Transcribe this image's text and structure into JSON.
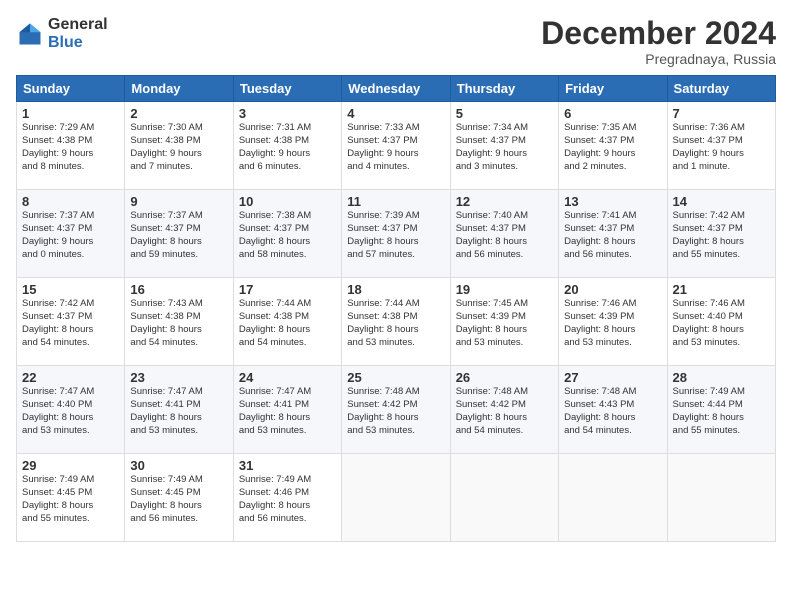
{
  "logo": {
    "general": "General",
    "blue": "Blue"
  },
  "header": {
    "month": "December 2024",
    "location": "Pregradnaya, Russia"
  },
  "weekdays": [
    "Sunday",
    "Monday",
    "Tuesday",
    "Wednesday",
    "Thursday",
    "Friday",
    "Saturday"
  ],
  "weeks": [
    [
      {
        "day": "1",
        "info": "Sunrise: 7:29 AM\nSunset: 4:38 PM\nDaylight: 9 hours\nand 8 minutes."
      },
      {
        "day": "2",
        "info": "Sunrise: 7:30 AM\nSunset: 4:38 PM\nDaylight: 9 hours\nand 7 minutes."
      },
      {
        "day": "3",
        "info": "Sunrise: 7:31 AM\nSunset: 4:38 PM\nDaylight: 9 hours\nand 6 minutes."
      },
      {
        "day": "4",
        "info": "Sunrise: 7:33 AM\nSunset: 4:37 PM\nDaylight: 9 hours\nand 4 minutes."
      },
      {
        "day": "5",
        "info": "Sunrise: 7:34 AM\nSunset: 4:37 PM\nDaylight: 9 hours\nand 3 minutes."
      },
      {
        "day": "6",
        "info": "Sunrise: 7:35 AM\nSunset: 4:37 PM\nDaylight: 9 hours\nand 2 minutes."
      },
      {
        "day": "7",
        "info": "Sunrise: 7:36 AM\nSunset: 4:37 PM\nDaylight: 9 hours\nand 1 minute."
      }
    ],
    [
      {
        "day": "8",
        "info": "Sunrise: 7:37 AM\nSunset: 4:37 PM\nDaylight: 9 hours\nand 0 minutes."
      },
      {
        "day": "9",
        "info": "Sunrise: 7:37 AM\nSunset: 4:37 PM\nDaylight: 8 hours\nand 59 minutes."
      },
      {
        "day": "10",
        "info": "Sunrise: 7:38 AM\nSunset: 4:37 PM\nDaylight: 8 hours\nand 58 minutes."
      },
      {
        "day": "11",
        "info": "Sunrise: 7:39 AM\nSunset: 4:37 PM\nDaylight: 8 hours\nand 57 minutes."
      },
      {
        "day": "12",
        "info": "Sunrise: 7:40 AM\nSunset: 4:37 PM\nDaylight: 8 hours\nand 56 minutes."
      },
      {
        "day": "13",
        "info": "Sunrise: 7:41 AM\nSunset: 4:37 PM\nDaylight: 8 hours\nand 56 minutes."
      },
      {
        "day": "14",
        "info": "Sunrise: 7:42 AM\nSunset: 4:37 PM\nDaylight: 8 hours\nand 55 minutes."
      }
    ],
    [
      {
        "day": "15",
        "info": "Sunrise: 7:42 AM\nSunset: 4:37 PM\nDaylight: 8 hours\nand 54 minutes."
      },
      {
        "day": "16",
        "info": "Sunrise: 7:43 AM\nSunset: 4:38 PM\nDaylight: 8 hours\nand 54 minutes."
      },
      {
        "day": "17",
        "info": "Sunrise: 7:44 AM\nSunset: 4:38 PM\nDaylight: 8 hours\nand 54 minutes."
      },
      {
        "day": "18",
        "info": "Sunrise: 7:44 AM\nSunset: 4:38 PM\nDaylight: 8 hours\nand 53 minutes."
      },
      {
        "day": "19",
        "info": "Sunrise: 7:45 AM\nSunset: 4:39 PM\nDaylight: 8 hours\nand 53 minutes."
      },
      {
        "day": "20",
        "info": "Sunrise: 7:46 AM\nSunset: 4:39 PM\nDaylight: 8 hours\nand 53 minutes."
      },
      {
        "day": "21",
        "info": "Sunrise: 7:46 AM\nSunset: 4:40 PM\nDaylight: 8 hours\nand 53 minutes."
      }
    ],
    [
      {
        "day": "22",
        "info": "Sunrise: 7:47 AM\nSunset: 4:40 PM\nDaylight: 8 hours\nand 53 minutes."
      },
      {
        "day": "23",
        "info": "Sunrise: 7:47 AM\nSunset: 4:41 PM\nDaylight: 8 hours\nand 53 minutes."
      },
      {
        "day": "24",
        "info": "Sunrise: 7:47 AM\nSunset: 4:41 PM\nDaylight: 8 hours\nand 53 minutes."
      },
      {
        "day": "25",
        "info": "Sunrise: 7:48 AM\nSunset: 4:42 PM\nDaylight: 8 hours\nand 53 minutes."
      },
      {
        "day": "26",
        "info": "Sunrise: 7:48 AM\nSunset: 4:42 PM\nDaylight: 8 hours\nand 54 minutes."
      },
      {
        "day": "27",
        "info": "Sunrise: 7:48 AM\nSunset: 4:43 PM\nDaylight: 8 hours\nand 54 minutes."
      },
      {
        "day": "28",
        "info": "Sunrise: 7:49 AM\nSunset: 4:44 PM\nDaylight: 8 hours\nand 55 minutes."
      }
    ],
    [
      {
        "day": "29",
        "info": "Sunrise: 7:49 AM\nSunset: 4:45 PM\nDaylight: 8 hours\nand 55 minutes."
      },
      {
        "day": "30",
        "info": "Sunrise: 7:49 AM\nSunset: 4:45 PM\nDaylight: 8 hours\nand 56 minutes."
      },
      {
        "day": "31",
        "info": "Sunrise: 7:49 AM\nSunset: 4:46 PM\nDaylight: 8 hours\nand 56 minutes."
      },
      {
        "day": "",
        "info": ""
      },
      {
        "day": "",
        "info": ""
      },
      {
        "day": "",
        "info": ""
      },
      {
        "day": "",
        "info": ""
      }
    ]
  ]
}
